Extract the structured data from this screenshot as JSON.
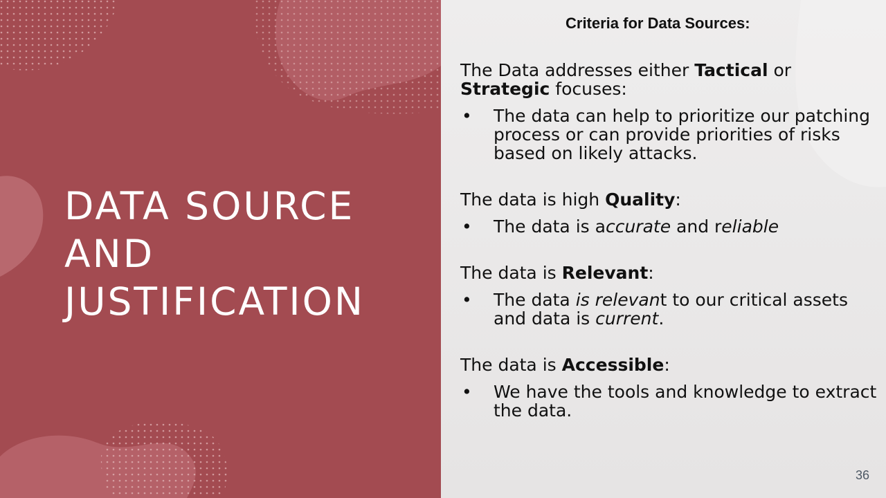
{
  "slide": {
    "title": "DATA SOURCE AND JUSTIFICATION",
    "heading": "Criteria for Data Sources:",
    "page_number": "36",
    "colors": {
      "left_panel": "#a34b51",
      "right_panel": "#e6e4e4",
      "title_text": "#ffffff"
    }
  },
  "criteria": [
    {
      "intro": {
        "pre": "The Data addresses either ",
        "bold1": "Tactical",
        "mid": " or ",
        "bold2": "Strategic",
        "post": " focuses:"
      },
      "bullet": {
        "text": "The data can help to prioritize our patching process or can provide priorities of risks based on likely attacks."
      }
    },
    {
      "intro": {
        "pre": " The data is high ",
        "bold": "Quality",
        "post": ":"
      },
      "bullet": {
        "pre": "The data is a",
        "italic1": "ccurate",
        "mid": " and r",
        "italic2": "eliable"
      }
    },
    {
      "intro": {
        "pre": "The data is ",
        "bold": "Relevant",
        "post": ":"
      },
      "bullet": {
        "pre": "The data ",
        "italic1": "is relevan",
        "mid": "t to our critical assets and data is ",
        "italic2": "current",
        "post": "."
      }
    },
    {
      "intro": {
        "pre": "The data is ",
        "bold": "Accessible",
        "post": ":"
      },
      "bullet": {
        "text": "We have the tools and knowledge to extract the data."
      }
    }
  ],
  "bullet_symbol": "•"
}
